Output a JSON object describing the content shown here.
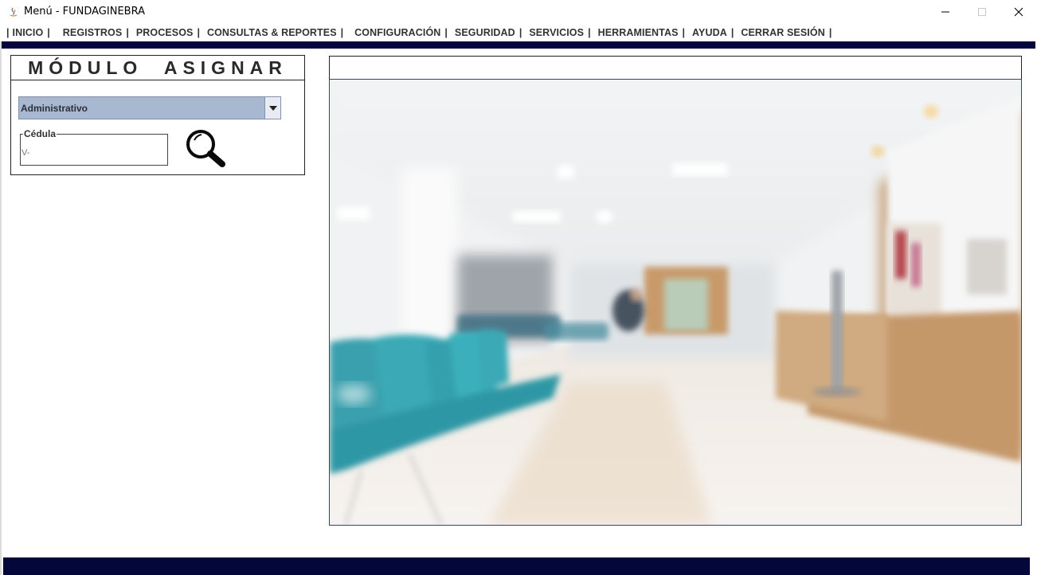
{
  "window": {
    "title": "Menú - FUNDAGINEBRA",
    "controls": [
      "minimize-icon",
      "maximize-icon",
      "close-icon"
    ]
  },
  "menu": {
    "lead": "|",
    "separator": "|",
    "items": [
      {
        "label": "INICIO"
      },
      {
        "label": "REGISTROS"
      },
      {
        "label": "PROCESOS"
      },
      {
        "label": "CONSULTAS & REPORTES"
      },
      {
        "label": "CONFIGURACIÓN"
      },
      {
        "label": "SEGURIDAD"
      },
      {
        "label": "SERVICIOS"
      },
      {
        "label": "HERRAMIENTAS"
      },
      {
        "label": "AYUDA"
      },
      {
        "label": "CERRAR SESIÓN"
      }
    ]
  },
  "module": {
    "title": "MÓDULO ASIGNAR",
    "combo_value": "Administrativo",
    "cedula_label": "Cédula",
    "cedula_value": "V-",
    "search_icon": "magnifier-icon"
  },
  "image_panel": {
    "header_text": "",
    "image_subject": "blurred-hospital-waiting-room"
  },
  "colors": {
    "navy_band": "#03073a",
    "combo_bg": "#a8b8d0",
    "chair_teal": "#3aa0ad"
  }
}
